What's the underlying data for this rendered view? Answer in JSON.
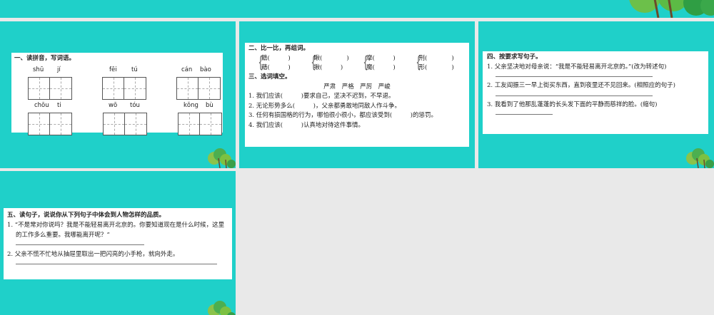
{
  "colors": {
    "teal": "#1fd0c9",
    "background": "#e9e9e9"
  },
  "slide1": {
    "title": "一、读拼音，写词语。",
    "words": [
      {
        "p1": "shū",
        "p2": "jí"
      },
      {
        "p1": "fēi",
        "p2": "tú"
      },
      {
        "p1": "cán",
        "p2": "bào"
      },
      {
        "p1": "chōu",
        "p2": "ti"
      },
      {
        "p1": "wō",
        "p2": "tóu"
      },
      {
        "p1": "kǒng",
        "p2": "bù"
      }
    ]
  },
  "slide2": {
    "title2": "二、比一比，再组词。",
    "pairs": [
      [
        "籍(　　　)",
        "藉(　　　)"
      ],
      [
        "瞅(　　　　)",
        "揪(　　　)"
      ],
      [
        "摩(　　　)",
        "魔(　　　)"
      ],
      [
        "刑(　　　　)",
        "形(　　　　)"
      ]
    ],
    "title3": "三、选词填空。",
    "options": "严肃　严格　严厉　严峻",
    "items": [
      "1. 我们应该(　　　)要求自己，坚决不迟到，不早退。",
      "2. 无论形势多么(　　　)，父亲都勇敢地同敌人作斗争。",
      "3. 任何有损国格的行为，哪怕很小很小，都应该受到(　　　)的惩罚。",
      "4. 我们应该(　　　)认真地对待这件事情。"
    ]
  },
  "slide3": {
    "title": "四、按要求写句子。",
    "items": [
      "1. 父亲坚决地对母亲说：“我是不能轻易离开北京的。”(改为转述句)",
      "2. 工友阎振三一早上街买东西，直到夜里还不见回来。(相照应的句子)",
      "3. 我看到了他那乱蓬蓬的长头发下面的平静而慈祥的脸。(缩句)"
    ]
  },
  "slide4": {
    "title": "五、读句子，说说你从下列句子中体会到人物怎样的品质。",
    "items": [
      "1. “不是常对你说吗？我是不能轻易离开北京的。你要知道现在是什么时候，这里的工作多么重要。我哪能离开呢？”",
      "2. 父亲不慌不忙地从抽屉里取出一把闪亮的小手枪，就向外走。"
    ]
  }
}
